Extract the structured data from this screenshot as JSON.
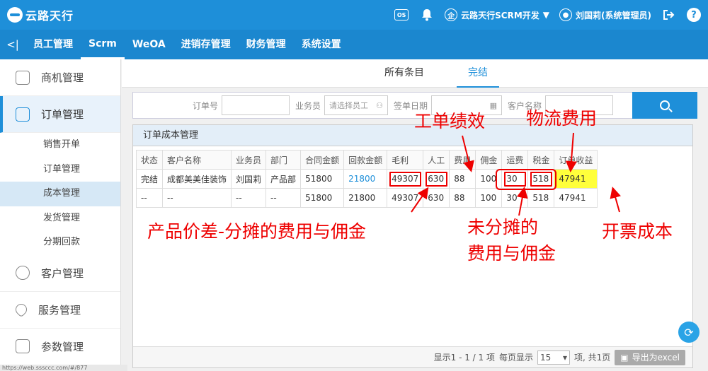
{
  "header": {
    "logo_text": "云路天行",
    "os_badge": "OS",
    "company": "云路天行SCRM开发",
    "company_icon": "企",
    "user": "刘国莉(系统管理员)",
    "help": "?"
  },
  "nav": {
    "back": "<|",
    "items": [
      "员工管理",
      "Scrm",
      "WeOA",
      "进销存管理",
      "财务管理",
      "系统设置"
    ]
  },
  "sidebar": {
    "groups": [
      "商机管理",
      "订单管理",
      "客户管理",
      "服务管理",
      "参数管理"
    ],
    "subs": [
      "销售开单",
      "订单管理",
      "成本管理",
      "发货管理",
      "分期回款"
    ]
  },
  "subtabs": [
    "所有条目",
    "完结"
  ],
  "filter": {
    "order_label": "订单号",
    "sales_label": "业务员",
    "sales_placeholder": "请选择员工",
    "date_label": "签单日期",
    "customer_label": "客户名称"
  },
  "panel_title": "订单成本管理",
  "table": {
    "headers": [
      "状态",
      "客户名称",
      "业务员",
      "部门",
      "合同金额",
      "回款金额",
      "毛利",
      "人工",
      "费用",
      "佣金",
      "运费",
      "税金",
      "订单收益"
    ],
    "rows": [
      [
        "完结",
        "成都美美佳装饰",
        "刘国莉",
        "产品部",
        "51800",
        "21800",
        "49307",
        "630",
        "88",
        "100",
        "30",
        "518",
        "47941"
      ],
      [
        "--",
        "--",
        "--",
        "--",
        "51800",
        "21800",
        "49307",
        "630",
        "88",
        "100",
        "30",
        "518",
        "47941"
      ]
    ]
  },
  "pager": {
    "display": "显示1 - 1 / 1 项",
    "per_page_label": "每页显示",
    "per_page": "15",
    "total": "项, 共1页",
    "export": "导出为excel"
  },
  "annotations": {
    "labor": "工单绩效",
    "freight": "物流费用",
    "gross": "产品价差-分摊的费用与佣金",
    "fees_line1": "未分摊的",
    "fees_line2": "费用与佣金",
    "tax": "开票成本"
  },
  "colors": {
    "primary": "#1e8fd9",
    "highlight": "#ffff3b",
    "annotation": "#e00000"
  },
  "status_url": "https://web.sssccc.com/#/877"
}
